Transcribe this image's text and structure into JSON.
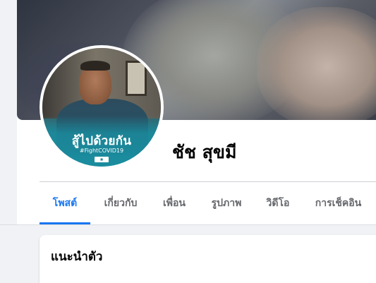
{
  "profile": {
    "name": "ชัช สุขมี",
    "avatar_frame": {
      "main_text": "สู้ไปด้วยกัน",
      "hashtag": "#FightCOVID19"
    }
  },
  "tabs": [
    {
      "label": "โพสต์",
      "active": true
    },
    {
      "label": "เกี่ยวกับ",
      "active": false
    },
    {
      "label": "เพื่อน",
      "active": false
    },
    {
      "label": "รูปภาพ",
      "active": false
    },
    {
      "label": "วิดีโอ",
      "active": false
    },
    {
      "label": "การเช็คอิน",
      "active": false
    }
  ],
  "intro_card": {
    "title": "แนะนำตัว"
  },
  "colors": {
    "accent": "#1877f2",
    "page_bg": "#f0f2f5",
    "frame_teal": "#1a8c9e"
  }
}
